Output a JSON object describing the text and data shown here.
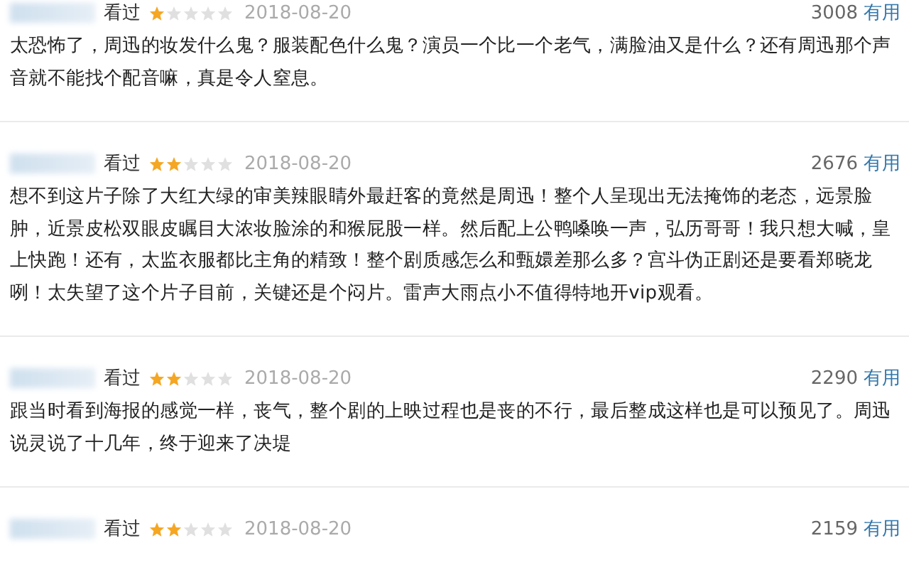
{
  "reviews": [
    {
      "status": "看过",
      "stars": 1,
      "date": "2018-08-20",
      "votes": "3008",
      "useful": "有用",
      "text": "太恐怖了，周迅的妆发什么鬼？服装配色什么鬼？演员一个比一个老气，满脸油又是什么？还有周迅那个声音就不能找个配音嘛，真是令人窒息。"
    },
    {
      "status": "看过",
      "stars": 2,
      "date": "2018-08-20",
      "votes": "2676",
      "useful": "有用",
      "text": "想不到这片子除了大红大绿的审美辣眼睛外最赶客的竟然是周迅！整个人呈现出无法掩饰的老态，远景脸肿，近景皮松双眼皮瞩目大浓妆脸涂的和猴屁股一样。然后配上公鸭嗓唤一声，弘历哥哥！我只想大喊，皇上快跑！还有，太监衣服都比主角的精致！整个剧质感怎么和甄嬛差那么多？宫斗伪正剧还是要看郑晓龙咧！太失望了这个片子目前，关键还是个闷片。雷声大雨点小不值得特地开vip观看。"
    },
    {
      "status": "看过",
      "stars": 2,
      "date": "2018-08-20",
      "votes": "2290",
      "useful": "有用",
      "text": "跟当时看到海报的感觉一样，丧气，整个剧的上映过程也是丧的不行，最后整成这样也是可以预见了。周迅说灵说了十几年，终于迎来了决堤"
    },
    {
      "status": "看过",
      "stars": 2,
      "date": "2018-08-20",
      "votes": "2159",
      "useful": "有用"
    }
  ]
}
